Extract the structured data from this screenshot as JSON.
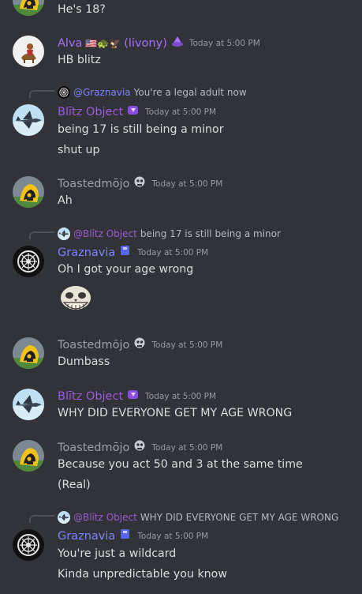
{
  "colors": {
    "background": "#313338",
    "text": "#dbdee1",
    "muted": "#949ba4",
    "blitz": "#9b59d6",
    "graznavia": "#7c83ff",
    "toasted": "#9aa0a8",
    "alva": "#a371f7"
  },
  "messages": {
    "m0": {
      "line1": "He's 18?"
    },
    "alva": {
      "username": "Alva",
      "flags": "🇺🇸🐢🦅",
      "suffix": "(livony)",
      "badge_icon": "purple-crystal-icon",
      "timestamp": "Today at 5:00 PM",
      "line1": "HB blitz"
    },
    "blitz1": {
      "reply_name": "@Graznavia",
      "reply_text": "You're a legal adult now",
      "username": "Blītz Object",
      "badge_icon": "purple-spark-icon",
      "timestamp": "Today at 5:00 PM",
      "line1": "being 17 is still being a minor",
      "line2": "shut up"
    },
    "toasted1": {
      "username": "Toastedmōjo",
      "badge_icon": "skull-badge-icon",
      "timestamp": "Today at 5:00 PM",
      "line1": "Ah"
    },
    "graz1": {
      "reply_name": "@Blītz Object",
      "reply_text": "being 17 is still being a minor",
      "username": "Graznavia",
      "badge_icon": "blue-flask-icon",
      "timestamp": "Today at 5:00 PM",
      "line1": "Oh I got your age wrong",
      "emoji": "troll-skull-emoji"
    },
    "toasted2": {
      "username": "Toastedmōjo",
      "timestamp": "Today at 5:00 PM",
      "line1": "Dumbass"
    },
    "blitz2": {
      "username": "Blītz Object",
      "timestamp": "Today at 5:00 PM",
      "line1": "WHY DID EVERYONE GET MY AGE WRONG"
    },
    "toasted3": {
      "username": "Toastedmōjo",
      "timestamp": "Today at 5:00 PM",
      "line1": "Because you act 50 and 3 at the same time",
      "line2": "(Real)"
    },
    "graz2": {
      "reply_name": "@Blītz Object",
      "reply_text": "WHY DID EVERYONE GET MY AGE WRONG",
      "username": "Graznavia",
      "timestamp": "Today at 5:00 PM",
      "line1": "You're just a wildcard",
      "line2": "Kinda unpredictable you know"
    }
  }
}
